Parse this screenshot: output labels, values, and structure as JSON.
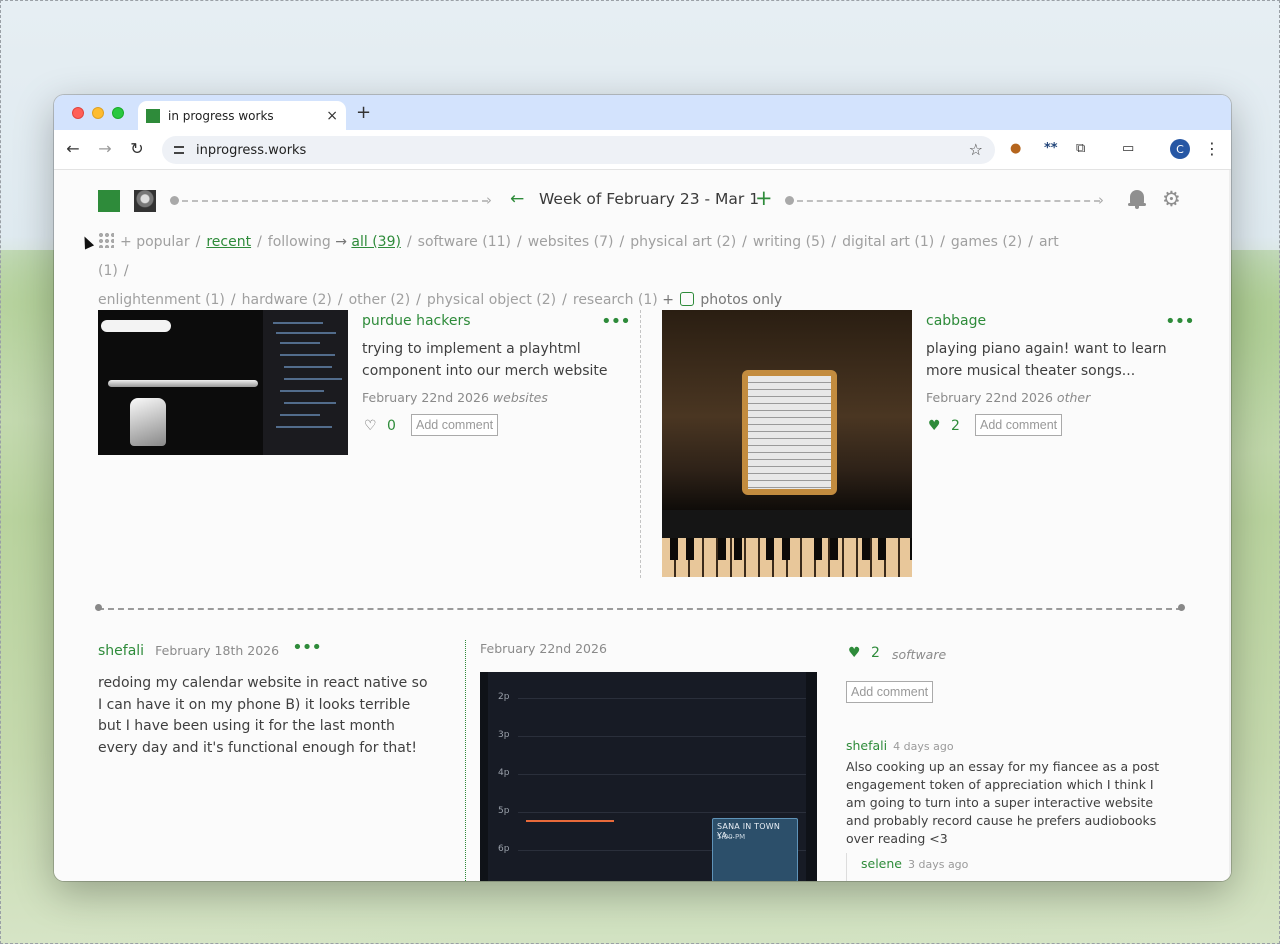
{
  "browser": {
    "tab_title": "in progress works",
    "url": "inprogress.works",
    "profile_initial": "C",
    "new_tab_symbol": "+",
    "close_symbol": "×"
  },
  "header": {
    "week_title": "Week of February 23 - Mar 1",
    "prev_symbol": "←",
    "add_symbol": "+"
  },
  "filters": {
    "items": [
      "popular",
      "recent",
      "following",
      "all (39)",
      "software (11)",
      "websites (7)",
      "physical art (2)",
      "writing (5)",
      "digital art (1)",
      "games (2)",
      "art (1)",
      "enlightenment (1)",
      "hardware (2)",
      "other (2)",
      "physical object (2)",
      "research (1)",
      "photos only"
    ],
    "plus": "+",
    "arrow": "→"
  },
  "posts": [
    {
      "author": "purdue hackers",
      "body": "trying to implement a playhtml component into our merch website",
      "date": "February 22nd 2026",
      "category": "websites",
      "likes": "0",
      "add_comment": "Add comment",
      "liked": false
    },
    {
      "author": "cabbage",
      "body": "playing piano again! want to learn more musical theater songs...",
      "date": "February 22nd 2026",
      "category": "other",
      "likes": "2",
      "add_comment": "Add comment",
      "liked": true
    },
    {
      "author": "shefali",
      "author_date": "February 18th 2026",
      "body": "redoing my calendar website in react native so I can have it on my phone B) it looks terrible but I have been using it for the last month every day and it's functional enough for that!",
      "update_date": "February 22nd 2026",
      "category": "software",
      "likes": "2",
      "add_comment": "Add comment",
      "liked": true,
      "calendar": {
        "hours": [
          "2p",
          "3p",
          "4p",
          "5p",
          "6p"
        ],
        "event_title": "SANA IN TOWN YA...",
        "event_time": "5:00 PM"
      },
      "comments": [
        {
          "author": "shefali",
          "time": "4 days ago",
          "body": "Also cooking up an essay for my fiancee as a post engagement token of appreciation which I think I am going to turn into a super interactive website and probably record cause he prefers audiobooks over reading <3"
        },
        {
          "author": "selene",
          "time": "3 days ago"
        }
      ]
    }
  ],
  "colors": {
    "accent": "#2e8b3a",
    "muted": "#a0a0a0"
  }
}
